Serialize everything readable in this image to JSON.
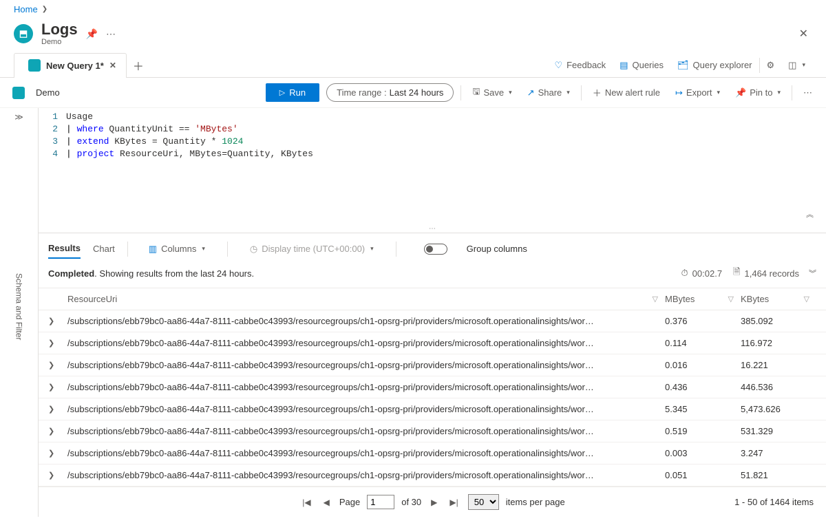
{
  "breadcrumb": {
    "home": "Home"
  },
  "header": {
    "title": "Logs",
    "subtitle": "Demo"
  },
  "tabs": {
    "active_label": "New Query 1*"
  },
  "top_actions": {
    "feedback": "Feedback",
    "queries": "Queries",
    "explorer": "Query explorer"
  },
  "action_bar": {
    "scope": "Demo",
    "run": "Run",
    "time_label": "Time range :",
    "time_value": "Last 24 hours",
    "save": "Save",
    "share": "Share",
    "new_alert": "New alert rule",
    "export": "Export",
    "pin": "Pin to"
  },
  "sidebar": {
    "label": "Schema and Filter"
  },
  "code": {
    "l1": "Usage",
    "l2": "| where QuantityUnit == 'MBytes'",
    "l3": "| extend KBytes = Quantity * 1024",
    "l4": "| project ResourceUri, MBytes=Quantity, KBytes"
  },
  "results_bar": {
    "tab_results": "Results",
    "tab_chart": "Chart",
    "columns": "Columns",
    "display_time": "Display time (UTC+00:00)",
    "group_cols": "Group columns"
  },
  "status": {
    "completed": "Completed",
    "detail": ". Showing results from the last 24 hours.",
    "elapsed": "00:02.7",
    "records": "1,464 records"
  },
  "columns": {
    "uri": "ResourceUri",
    "mbytes": "MBytes",
    "kbytes": "KBytes"
  },
  "rows": [
    {
      "uri": "/subscriptions/ebb79bc0-aa86-44a7-8111-cabbe0c43993/resourcegroups/ch1-opsrg-pri/providers/microsoft.operationalinsights/wor…",
      "mbytes": "0.376",
      "kbytes": "385.092"
    },
    {
      "uri": "/subscriptions/ebb79bc0-aa86-44a7-8111-cabbe0c43993/resourcegroups/ch1-opsrg-pri/providers/microsoft.operationalinsights/wor…",
      "mbytes": "0.114",
      "kbytes": "116.972"
    },
    {
      "uri": "/subscriptions/ebb79bc0-aa86-44a7-8111-cabbe0c43993/resourcegroups/ch1-opsrg-pri/providers/microsoft.operationalinsights/wor…",
      "mbytes": "0.016",
      "kbytes": "16.221"
    },
    {
      "uri": "/subscriptions/ebb79bc0-aa86-44a7-8111-cabbe0c43993/resourcegroups/ch1-opsrg-pri/providers/microsoft.operationalinsights/wor…",
      "mbytes": "0.436",
      "kbytes": "446.536"
    },
    {
      "uri": "/subscriptions/ebb79bc0-aa86-44a7-8111-cabbe0c43993/resourcegroups/ch1-opsrg-pri/providers/microsoft.operationalinsights/wor…",
      "mbytes": "5.345",
      "kbytes": "5,473.626"
    },
    {
      "uri": "/subscriptions/ebb79bc0-aa86-44a7-8111-cabbe0c43993/resourcegroups/ch1-opsrg-pri/providers/microsoft.operationalinsights/wor…",
      "mbytes": "0.519",
      "kbytes": "531.329"
    },
    {
      "uri": "/subscriptions/ebb79bc0-aa86-44a7-8111-cabbe0c43993/resourcegroups/ch1-opsrg-pri/providers/microsoft.operationalinsights/wor…",
      "mbytes": "0.003",
      "kbytes": "3.247"
    },
    {
      "uri": "/subscriptions/ebb79bc0-aa86-44a7-8111-cabbe0c43993/resourcegroups/ch1-opsrg-pri/providers/microsoft.operationalinsights/wor…",
      "mbytes": "0.051",
      "kbytes": "51.821"
    }
  ],
  "pager": {
    "label_page": "Page",
    "current": "1",
    "of": "of 30",
    "page_size": "50",
    "per_page": "items per page",
    "summary": "1 - 50 of 1464 items"
  }
}
